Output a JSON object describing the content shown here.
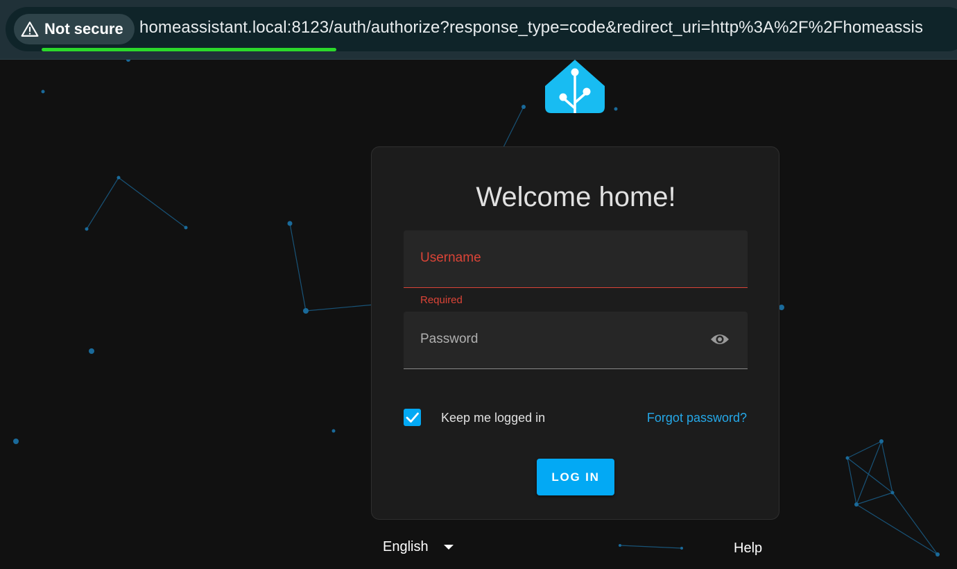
{
  "browser": {
    "security_label": "Not secure",
    "url": "homeassistant.local:8123/auth/authorize?response_type=code&redirect_uri=http%3A%2F%2Fhomeassis",
    "progress": 0.35
  },
  "login": {
    "title": "Welcome home!",
    "username_label": "Username",
    "username_helper": "Required",
    "password_label": "Password",
    "keep_logged_in_label": "Keep me logged in",
    "keep_logged_in_checked": true,
    "forgot_password": "Forgot password?",
    "login_button": "LOG IN"
  },
  "footer": {
    "language": "English",
    "help": "Help"
  },
  "colors": {
    "accent": "#03a9f4",
    "error": "#db4437",
    "background": "#111111",
    "card": "#1c1c1c"
  },
  "icons": {
    "security": "warning-icon",
    "password_toggle": "eye-icon",
    "checkbox": "check-icon",
    "language": "chevron-down-icon",
    "brand": "home-assistant-logo"
  }
}
